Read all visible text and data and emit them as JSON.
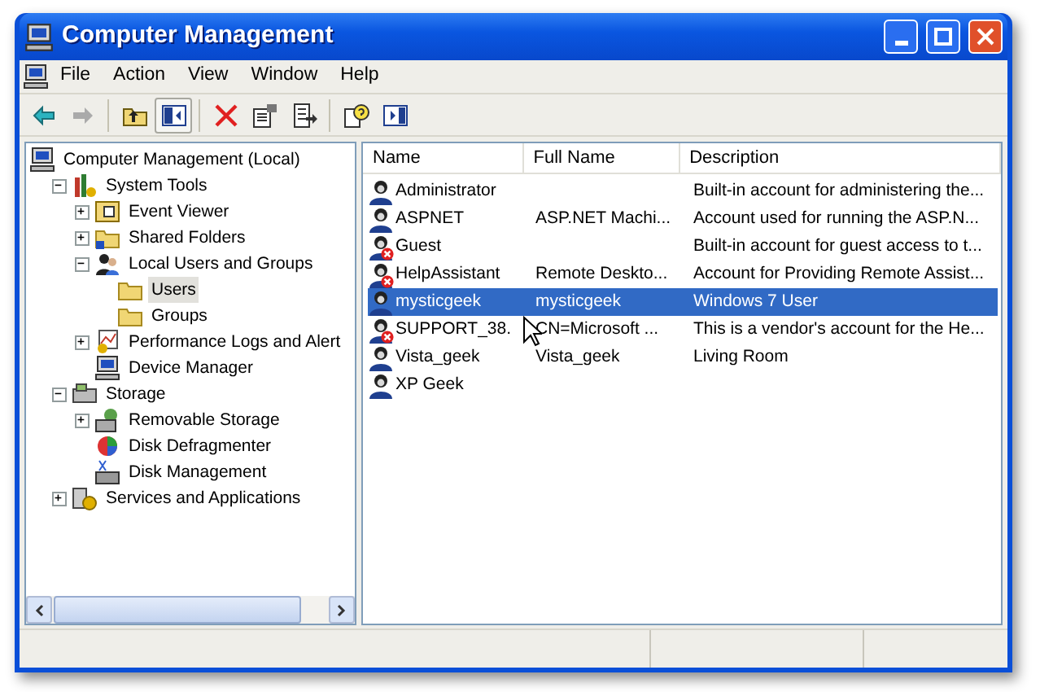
{
  "window": {
    "title": "Computer Management"
  },
  "menu": [
    "File",
    "Action",
    "View",
    "Window",
    "Help"
  ],
  "toolbar": [
    {
      "kind": "back",
      "disabled": false
    },
    {
      "kind": "forward",
      "disabled": true
    },
    {
      "kind": "sep"
    },
    {
      "kind": "up"
    },
    {
      "kind": "tree",
      "pressed": true
    },
    {
      "kind": "sep"
    },
    {
      "kind": "delete",
      "disabled": false
    },
    {
      "kind": "properties"
    },
    {
      "kind": "export"
    },
    {
      "kind": "sep"
    },
    {
      "kind": "help"
    },
    {
      "kind": "pane"
    }
  ],
  "tree": [
    {
      "label": "Computer Management (Local)",
      "kind": "computer",
      "selected": false,
      "children": [
        {
          "label": "System Tools",
          "kind": "tools",
          "expanded": true,
          "selected": false,
          "children": [
            {
              "label": "Event Viewer",
              "kind": "log",
              "expanded": false,
              "selected": false
            },
            {
              "label": "Shared Folders",
              "kind": "share",
              "expanded": false,
              "selected": false
            },
            {
              "label": "Local Users and Groups",
              "kind": "users",
              "expanded": true,
              "selected": false,
              "children": [
                {
                  "label": "Users",
                  "kind": "folder",
                  "selected": true
                },
                {
                  "label": "Groups",
                  "kind": "folder",
                  "selected": false
                }
              ]
            },
            {
              "label": "Performance Logs and Alert",
              "kind": "chart",
              "expanded": false,
              "selected": false
            },
            {
              "label": "Device Manager",
              "kind": "device",
              "selected": false
            }
          ]
        },
        {
          "label": "Storage",
          "kind": "storage",
          "expanded": true,
          "selected": false,
          "children": [
            {
              "label": "Removable Storage",
              "kind": "removable",
              "expanded": false,
              "selected": false
            },
            {
              "label": "Disk Defragmenter",
              "kind": "defrag",
              "selected": false
            },
            {
              "label": "Disk Management",
              "kind": "disk",
              "selected": false
            }
          ]
        },
        {
          "label": "Services and Applications",
          "kind": "services",
          "expanded": false,
          "selected": false
        }
      ]
    }
  ],
  "table": {
    "columns": [
      "Name",
      "Full Name",
      "Description"
    ],
    "rows": [
      {
        "name": "Administrator",
        "full_name": "",
        "description": "Built-in account for administering the...",
        "disabled": false,
        "selected": false
      },
      {
        "name": "ASPNET",
        "full_name": "ASP.NET Machi...",
        "description": "Account used for running the ASP.N...",
        "disabled": false,
        "selected": false
      },
      {
        "name": "Guest",
        "full_name": "",
        "description": "Built-in account for guest access to t...",
        "disabled": true,
        "selected": false
      },
      {
        "name": "HelpAssistant",
        "full_name": "Remote Deskto...",
        "description": "Account for Providing Remote Assist...",
        "disabled": true,
        "selected": false
      },
      {
        "name": "mysticgeek",
        "full_name": "mysticgeek",
        "description": "Windows 7 User",
        "disabled": false,
        "selected": true
      },
      {
        "name": "SUPPORT_38.",
        "full_name": "CN=Microsoft ...",
        "description": "This is a vendor's account for the He...",
        "disabled": true,
        "selected": false
      },
      {
        "name": "Vista_geek",
        "full_name": "Vista_geek",
        "description": "Living Room",
        "disabled": false,
        "selected": false
      },
      {
        "name": "XP Geek",
        "full_name": "",
        "description": "",
        "disabled": false,
        "selected": false
      }
    ]
  }
}
